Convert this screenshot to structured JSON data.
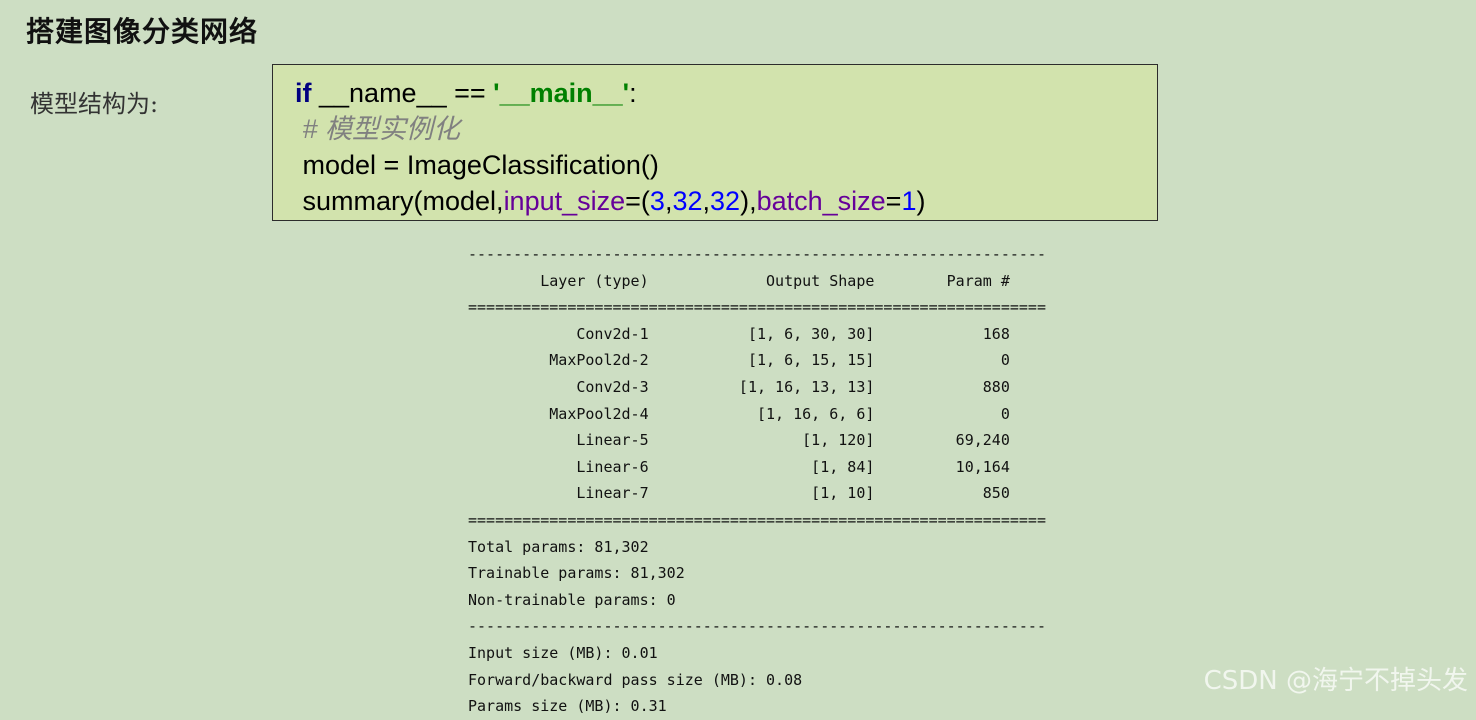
{
  "page": {
    "title": "搭建图像分类网络",
    "side_label": "模型结构为:"
  },
  "code": {
    "line1": {
      "kw": "if",
      "t1": " __name__ == ",
      "str": "'__main__'",
      "t2": ":"
    },
    "line2": {
      "comment": "# 模型实例化"
    },
    "line3": {
      "text": "model = ImageClassification()"
    },
    "line4": {
      "t1": "summary(model,",
      "p1": "input_size",
      "t2": "=(",
      "n1": "3",
      "c1": ",",
      "n2": "32",
      "c2": ",",
      "n3": "32",
      "t3": "),",
      "p2": "batch_size",
      "t4": "=",
      "n4": "1",
      "t5": ")"
    }
  },
  "summary": {
    "separator_dash": "----------------------------------------------------------------",
    "separator_eq": "================================================================",
    "header": {
      "layer": "Layer (type)",
      "shape": "Output Shape",
      "param": "Param #"
    },
    "rows": [
      {
        "layer": "Conv2d-1",
        "shape": "[1, 6, 30, 30]",
        "param": "168"
      },
      {
        "layer": "MaxPool2d-2",
        "shape": "[1, 6, 15, 15]",
        "param": "0"
      },
      {
        "layer": "Conv2d-3",
        "shape": "[1, 16, 13, 13]",
        "param": "880"
      },
      {
        "layer": "MaxPool2d-4",
        "shape": "[1, 16, 6, 6]",
        "param": "0"
      },
      {
        "layer": "Linear-5",
        "shape": "[1, 120]",
        "param": "69,240"
      },
      {
        "layer": "Linear-6",
        "shape": "[1, 84]",
        "param": "10,164"
      },
      {
        "layer": "Linear-7",
        "shape": "[1, 10]",
        "param": "850"
      }
    ],
    "totals": [
      "Total params: 81,302",
      "Trainable params: 81,302",
      "Non-trainable params: 0"
    ],
    "sizes": [
      "Input size (MB): 0.01",
      "Forward/backward pass size (MB): 0.08",
      "Params size (MB): 0.31"
    ]
  },
  "watermark": "CSDN @海宁不掉头发"
}
